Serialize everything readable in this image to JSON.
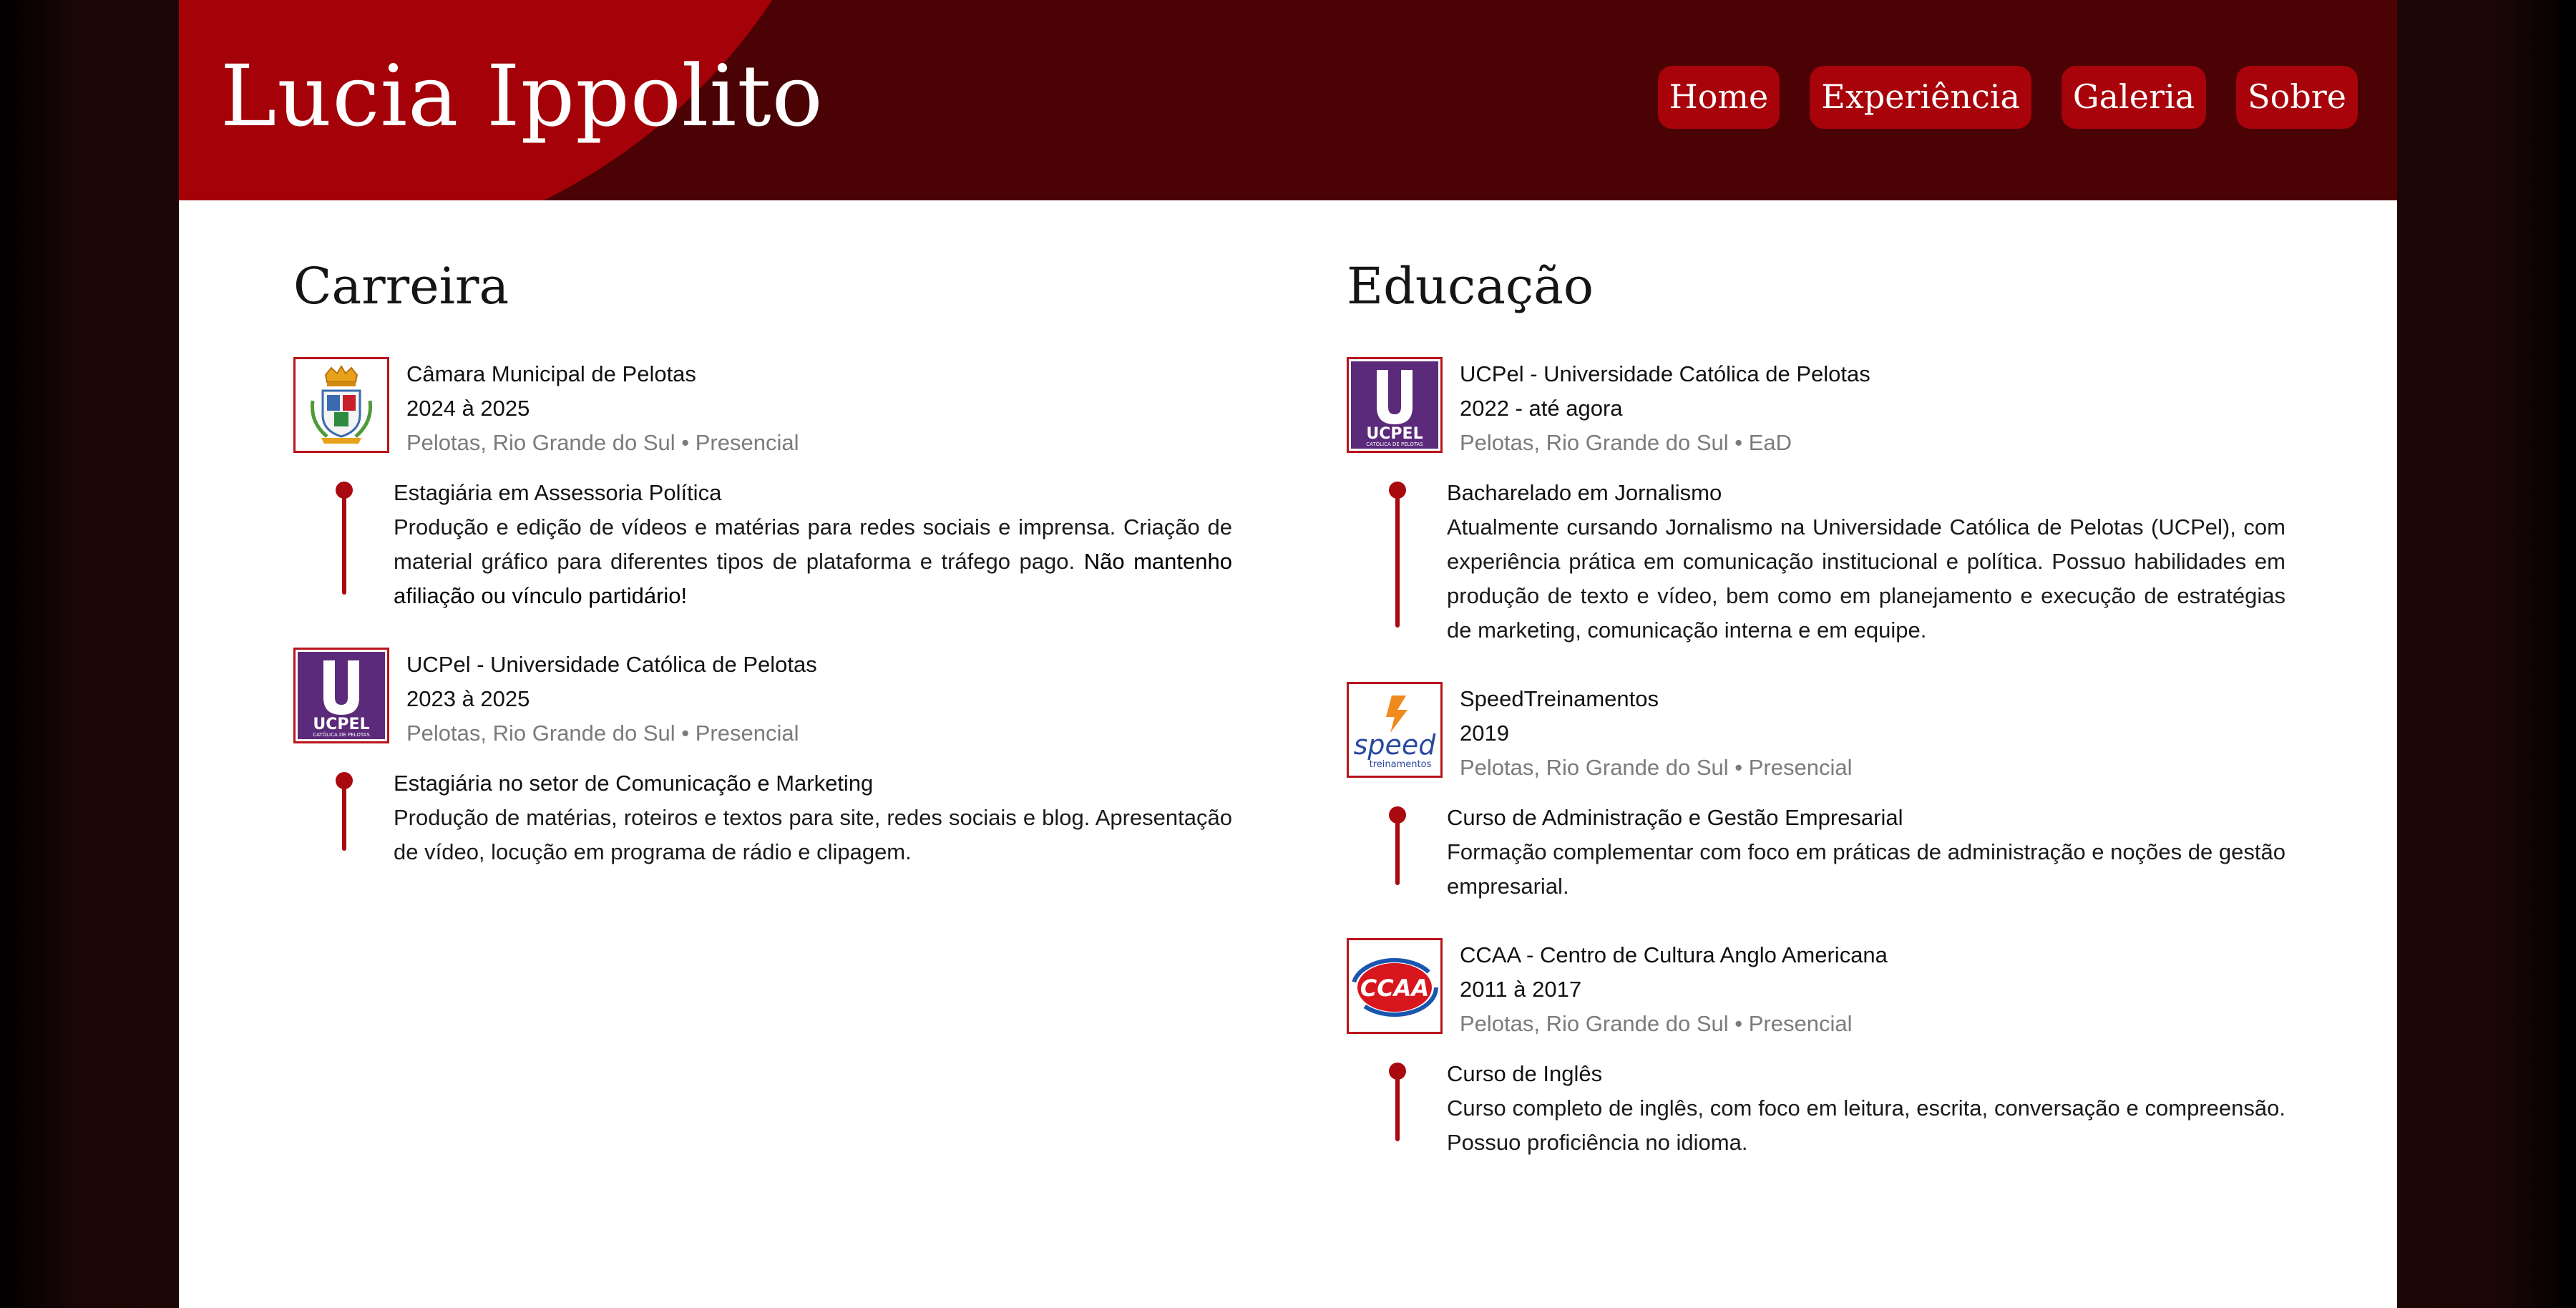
{
  "header": {
    "title": "Lucia Ippolito",
    "nav": [
      {
        "label": "Home"
      },
      {
        "label": "Experiência"
      },
      {
        "label": "Galeria"
      },
      {
        "label": "Sobre"
      }
    ]
  },
  "career": {
    "heading": "Carreira",
    "entries": [
      {
        "logo": "camara-pelotas-crest-icon",
        "org": "Câmara Municipal de Pelotas",
        "dates": "2024 à 2025",
        "meta": "Pelotas, Rio Grande do Sul • Presencial",
        "role": "Estagiária em Assessoria Política",
        "desc": "Produção e edição de vídeos e matérias para redes sociais e imprensa. Criação de material gráfico para diferentes tipos de plataforma e tráfego pago.",
        "desc_bold": "Não mantenho afiliação ou vínculo partidário!"
      },
      {
        "logo": "ucpel-logo-icon",
        "org": "UCPel - Universidade Católica de Pelotas",
        "dates": "2023 à 2025",
        "meta": "Pelotas, Rio Grande do Sul • Presencial",
        "role": "Estagiária no setor de Comunicação e Marketing",
        "desc": "Produção de matérias, roteiros e textos para site, redes sociais e blog. Apresentação de vídeo, locução em programa de rádio e clipagem."
      }
    ]
  },
  "education": {
    "heading": "Educação",
    "entries": [
      {
        "logo": "ucpel-logo-icon",
        "org": "UCPel - Universidade Católica de Pelotas",
        "dates": "2022 - até agora",
        "meta": "Pelotas, Rio Grande do Sul • EaD",
        "role": "Bacharelado em Jornalismo",
        "desc": "Atualmente cursando Jornalismo na Universidade Católica de Pelotas (UCPel), com experiência prática em comunicação institucional e política. Possuo habilidades em produção de texto e vídeo, bem como em planejamento e execução de estratégias de marketing, comunicação interna e em equipe."
      },
      {
        "logo": "speed-treinamentos-logo-icon",
        "org": "SpeedTreinamentos",
        "dates": "2019",
        "meta": "Pelotas, Rio Grande do Sul • Presencial",
        "role": "Curso de Administração e Gestão Empresarial",
        "desc": "Formação complementar com foco em práticas de administração e noções de gestão empresarial."
      },
      {
        "logo": "ccaa-logo-icon",
        "org": "CCAA - Centro de Cultura Anglo Americana",
        "dates": "2011 à 2017",
        "meta": "Pelotas, Rio Grande do Sul • Presencial",
        "role": "Curso de Inglês",
        "desc": "Curso completo de inglês, com foco em leitura, escrita, conversação e compreensão. Possuo proficiência no idioma."
      }
    ]
  },
  "logo_text": {
    "ucpel": "UCPEL",
    "ucpel_sub": "CATÓLICA DE PELOTAS",
    "speed": "speed",
    "speed_sub": "treinamentos",
    "ccaa": "CCAA"
  },
  "colors": {
    "header_bg": "#4a0204",
    "accent": "#a8030a",
    "timeline": "#a80a10",
    "muted_text": "#7b7b7b"
  }
}
